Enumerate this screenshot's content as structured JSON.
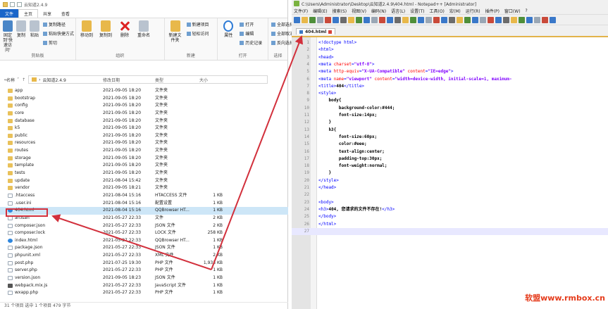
{
  "explorer": {
    "title": "云知道2.4.9",
    "tabs": [
      "文件",
      "主页",
      "共享",
      "查看"
    ],
    "ribbon": {
      "clipboard": {
        "label": "剪贴板",
        "pin": "固定到'快速访问'",
        "copy": "复制",
        "paste": "粘贴",
        "copy_path": "复制路径",
        "paste_shortcut": "粘贴快捷方式",
        "cut": "剪切"
      },
      "organize": {
        "label": "组织",
        "move_to": "移动到",
        "copy_to": "复制到",
        "delete": "删除",
        "rename": "重命名"
      },
      "new": {
        "label": "新建",
        "new_folder": "新建文件夹",
        "new_item": "新建项目",
        "easy_access": "轻松访问"
      },
      "open": {
        "label": "打开",
        "properties": "属性",
        "open": "打开",
        "edit": "编辑",
        "history": "历史记录"
      },
      "select": {
        "label": "选择",
        "select_all": "全部选择",
        "select_none": "全部取消",
        "invert": "反向选择"
      }
    },
    "address": "云知道2.4.9",
    "columns": {
      "name": "名称",
      "date": "修改日期",
      "type": "类型",
      "size": "大小"
    },
    "files": [
      {
        "name": "app",
        "date": "2021-09-05 18:20",
        "type": "文件夹",
        "size": "",
        "icon": "folder"
      },
      {
        "name": "bootstrap",
        "date": "2021-09-05 18:20",
        "type": "文件夹",
        "size": "",
        "icon": "folder"
      },
      {
        "name": "config",
        "date": "2021-09-05 18:20",
        "type": "文件夹",
        "size": "",
        "icon": "folder"
      },
      {
        "name": "core",
        "date": "2021-09-05 18:20",
        "type": "文件夹",
        "size": "",
        "icon": "folder"
      },
      {
        "name": "database",
        "date": "2021-09-05 18:20",
        "type": "文件夹",
        "size": "",
        "icon": "folder"
      },
      {
        "name": "k5",
        "date": "2021-09-05 18:20",
        "type": "文件夹",
        "size": "",
        "icon": "folder"
      },
      {
        "name": "public",
        "date": "2021-09-05 18:20",
        "type": "文件夹",
        "size": "",
        "icon": "folder"
      },
      {
        "name": "resources",
        "date": "2021-09-05 18:20",
        "type": "文件夹",
        "size": "",
        "icon": "folder"
      },
      {
        "name": "routes",
        "date": "2021-09-05 18:20",
        "type": "文件夹",
        "size": "",
        "icon": "folder"
      },
      {
        "name": "storage",
        "date": "2021-09-05 18:20",
        "type": "文件夹",
        "size": "",
        "icon": "folder"
      },
      {
        "name": "template",
        "date": "2021-09-05 18:20",
        "type": "文件夹",
        "size": "",
        "icon": "folder"
      },
      {
        "name": "tests",
        "date": "2021-09-05 18:20",
        "type": "文件夹",
        "size": "",
        "icon": "folder"
      },
      {
        "name": "update",
        "date": "2021-08-04 15:42",
        "type": "文件夹",
        "size": "",
        "icon": "folder"
      },
      {
        "name": "vendor",
        "date": "2021-09-05 18:21",
        "type": "文件夹",
        "size": "",
        "icon": "folder"
      },
      {
        "name": ".htaccess",
        "date": "2021-08-04 15:16",
        "type": "HTACCESS 文件",
        "size": "1 KB",
        "icon": "file"
      },
      {
        "name": ".user.ini",
        "date": "2021-08-04 15:16",
        "type": "配置设置",
        "size": "1 KB",
        "icon": "file"
      },
      {
        "name": "404.html",
        "date": "2021-08-04 15:16",
        "type": "QQBrowser HT...",
        "size": "1 KB",
        "icon": "browser"
      },
      {
        "name": "artisan",
        "date": "2021-05-27 22:33",
        "type": "文件",
        "size": "2 KB",
        "icon": "file"
      },
      {
        "name": "composer.json",
        "date": "2021-05-27 22:33",
        "type": "JSON 文件",
        "size": "2 KB",
        "icon": "file"
      },
      {
        "name": "composer.lock",
        "date": "2021-05-27 22:33",
        "type": "LOCK 文件",
        "size": "258 KB",
        "icon": "file"
      },
      {
        "name": "index.html",
        "date": "2021-05-27 22:33",
        "type": "QQBrowser HT...",
        "size": "1 KB",
        "icon": "browser"
      },
      {
        "name": "package.json",
        "date": "2021-05-27 22:33",
        "type": "JSON 文件",
        "size": "1 KB",
        "icon": "file"
      },
      {
        "name": "phpunit.xml",
        "date": "2021-05-27 22:33",
        "type": "XML 文件",
        "size": "2 KB",
        "icon": "file"
      },
      {
        "name": "post.php",
        "date": "2021-07-25 19:30",
        "type": "PHP 文件",
        "size": "1,933 KB",
        "icon": "file"
      },
      {
        "name": "server.php",
        "date": "2021-05-27 22:33",
        "type": "PHP 文件",
        "size": "1 KB",
        "icon": "file"
      },
      {
        "name": "version.json",
        "date": "2021-09-05 18:23",
        "type": "JSON 文件",
        "size": "1 KB",
        "icon": "file"
      },
      {
        "name": "webpack.mix.js",
        "date": "2021-05-27 22:33",
        "type": "JavaScript 文件",
        "size": "1 KB",
        "icon": "js"
      },
      {
        "name": "wxapp.php",
        "date": "2021-05-27 22:33",
        "type": "PHP 文件",
        "size": "1 KB",
        "icon": "file"
      }
    ],
    "status": "31 个项目   选中 1 个项目  479 字节"
  },
  "npp": {
    "title": "C:\\Users\\Administrator\\Desktop\\云知道2.4.9\\404.html - Notepad++ [Administrator]",
    "menu": [
      "文件(F)",
      "编辑(E)",
      "搜索(S)",
      "视图(V)",
      "编码(N)",
      "语言(L)",
      "设置(T)",
      "工具(O)",
      "宏(M)",
      "运行(R)",
      "插件(P)",
      "窗口(W)",
      "?"
    ],
    "tab": "404.html",
    "toolbar_colors": [
      "#3a78c9",
      "#e8b84a",
      "#4f8f3a",
      "#9aa7b5",
      "#c94a3a",
      "#3a78c9",
      "#6c6c6c",
      "#e8b84a",
      "#4f8f3a",
      "#3a78c9",
      "#9aa7b5",
      "#c94a3a",
      "#3a78c9",
      "#6c6c6c",
      "#e8b84a",
      "#4f8f3a",
      "#3a78c9",
      "#9aa7b5",
      "#c94a3a",
      "#3a78c9",
      "#6c6c6c",
      "#e8b84a",
      "#4f8f3a",
      "#3a78c9",
      "#9aa7b5",
      "#c94a3a",
      "#3a78c9",
      "#6c6c6c",
      "#e8b84a",
      "#4f8f3a",
      "#3a78c9",
      "#9aa7b5",
      "#c94a3a",
      "#3a78c9"
    ],
    "lines": [
      [
        [
          "tag",
          "<!doctype html>"
        ]
      ],
      [
        [
          "tag",
          "<html>"
        ]
      ],
      [
        [
          "tag",
          "<head>"
        ]
      ],
      [
        [
          "tag",
          "<meta "
        ],
        [
          "attr",
          "charset"
        ],
        [
          "tag",
          "="
        ],
        [
          "val",
          "\"utf-8\""
        ],
        [
          "tag",
          ">"
        ]
      ],
      [
        [
          "tag",
          "<meta "
        ],
        [
          "attr",
          "http-equiv"
        ],
        [
          "tag",
          "="
        ],
        [
          "val",
          "\"X-UA-Compatible\""
        ],
        [
          "tag",
          " "
        ],
        [
          "attr",
          "content"
        ],
        [
          "tag",
          "="
        ],
        [
          "val",
          "\"IE=edge\""
        ],
        [
          "tag",
          ">"
        ]
      ],
      [
        [
          "tag",
          "<meta "
        ],
        [
          "attr",
          "name"
        ],
        [
          "tag",
          "="
        ],
        [
          "val",
          "\"viewport\""
        ],
        [
          "tag",
          " "
        ],
        [
          "attr",
          "content"
        ],
        [
          "tag",
          "="
        ],
        [
          "val",
          "\"width=device-width, initial-scale=1, maximum-"
        ]
      ],
      [
        [
          "tag",
          "<title>"
        ],
        [
          "prop",
          "404"
        ],
        [
          "tag",
          "</title>"
        ]
      ],
      [
        [
          "tag",
          "<style>"
        ]
      ],
      [
        [
          "prop",
          "    body{"
        ]
      ],
      [
        [
          "prop",
          "        background-color:#444;"
        ]
      ],
      [
        [
          "prop",
          "        font-size:14px;"
        ]
      ],
      [
        [
          "prop",
          "    }"
        ]
      ],
      [
        [
          "prop",
          "    h3{"
        ]
      ],
      [
        [
          "prop",
          "        font-size:60px;"
        ]
      ],
      [
        [
          "prop",
          "        color:#eee;"
        ]
      ],
      [
        [
          "prop",
          "        text-align:center;"
        ]
      ],
      [
        [
          "prop",
          "        padding-top:30px;"
        ]
      ],
      [
        [
          "prop",
          "        font-weight:normal;"
        ]
      ],
      [
        [
          "prop",
          "    }"
        ]
      ],
      [
        [
          "tag",
          "</style>"
        ]
      ],
      [
        [
          "tag",
          "</head>"
        ]
      ],
      [
        [
          "prop",
          ""
        ]
      ],
      [
        [
          "tag",
          "<body>"
        ]
      ],
      [
        [
          "tag",
          "<h3>"
        ],
        [
          "prop",
          "404, 您请求的文件不存在!"
        ],
        [
          "tag",
          "</h3>"
        ]
      ],
      [
        [
          "tag",
          "</body>"
        ]
      ],
      [
        [
          "tag",
          "</html>"
        ]
      ],
      [
        [
          "prop",
          ""
        ]
      ]
    ]
  },
  "watermark": "软盟www.rmbox.cn"
}
